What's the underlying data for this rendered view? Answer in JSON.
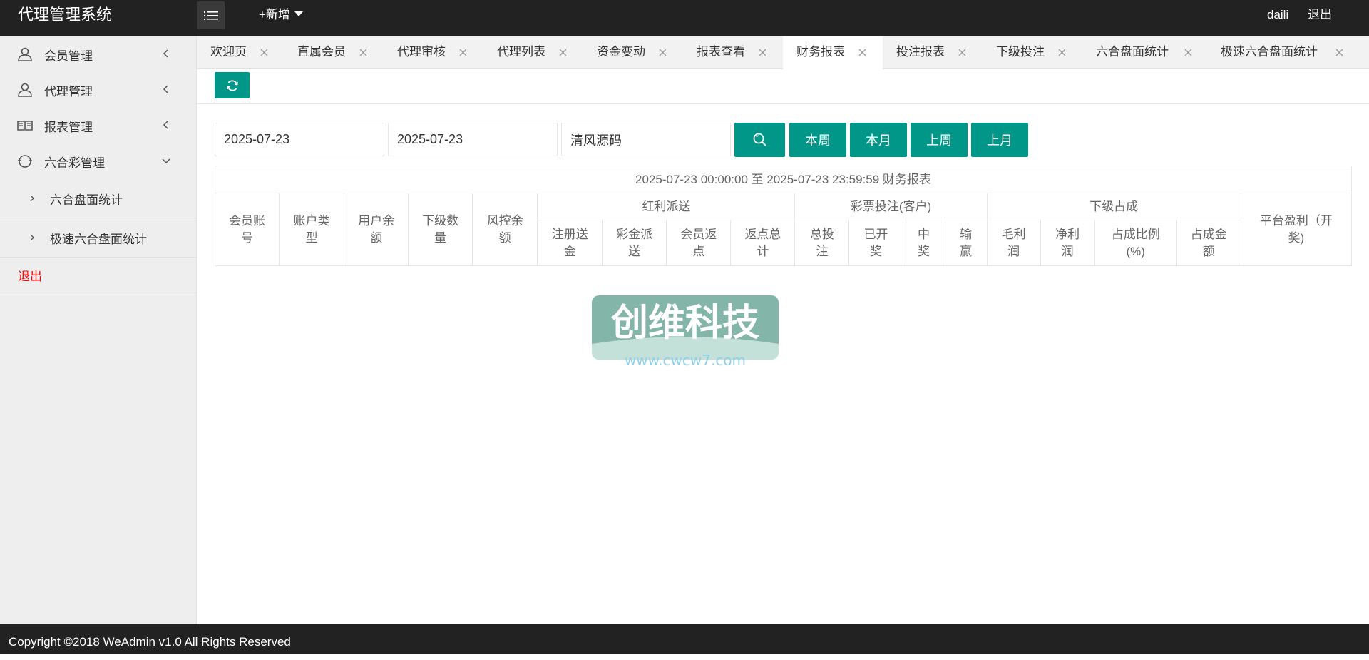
{
  "header": {
    "app_title": "代理管理系统",
    "add_new_label": "+新增",
    "username": "daili",
    "logout_label": "退出"
  },
  "sidebar": {
    "items": [
      {
        "label": "会员管理",
        "icon": "user-icon",
        "expanded": false
      },
      {
        "label": "代理管理",
        "icon": "user-icon",
        "expanded": false
      },
      {
        "label": "报表管理",
        "icon": "book-icon",
        "expanded": false
      },
      {
        "label": "六合彩管理",
        "icon": "lottery-icon",
        "expanded": true
      }
    ],
    "subitems": [
      {
        "label": "六合盘面统计"
      },
      {
        "label": "极速六合盘面统计"
      }
    ],
    "exit_label": "退出"
  },
  "tabs": [
    {
      "label": "欢迎页"
    },
    {
      "label": "直属会员"
    },
    {
      "label": "代理审核"
    },
    {
      "label": "代理列表"
    },
    {
      "label": "资金变动"
    },
    {
      "label": "报表查看"
    },
    {
      "label": "财务报表",
      "active": true
    },
    {
      "label": "投注报表"
    },
    {
      "label": "下级投注"
    },
    {
      "label": "六合盘面统计"
    },
    {
      "label": "极速六合盘面统计"
    }
  ],
  "filters": {
    "start_date": "2025-07-23",
    "end_date": "2025-07-23",
    "keyword": "清风源码",
    "btn_this_week": "本周",
    "btn_this_month": "本月",
    "btn_last_week": "上周",
    "btn_last_month": "上月"
  },
  "table": {
    "caption": "2025-07-23 00:00:00 至 2025-07-23 23:59:59 财务报表",
    "col_member_account": "会员账号",
    "col_account_type": "账户类型",
    "col_user_balance": "用户余额",
    "col_sub_count": "下级数量",
    "col_risk_balance": "风控余额",
    "group_bonus": "红利派送",
    "col_reg_bonus": "注册送金",
    "col_jackpot": "彩金派送",
    "col_member_rebate": "会员返点",
    "col_rebate_total": "返点总计",
    "group_bets": "彩票投注(客户)",
    "col_total_bets": "总投注",
    "col_drawn": "已开奖",
    "col_win": "中奖",
    "col_win_loss": "输赢",
    "group_share": "下级占成",
    "col_gross_profit": "毛利润",
    "col_net_profit": "净利润",
    "col_share_ratio": "占成比例(%)",
    "col_share_amount": "占成金额",
    "col_platform_profit": "平台盈利（开奖)"
  },
  "watermark": {
    "brand": "创维科技",
    "url": "www.cwcw7.com"
  },
  "footer": {
    "copyright": "Copyright ©2018 WeAdmin v1.0 All Rights Reserved"
  },
  "colors": {
    "primary": "#009688",
    "header_bg": "#222222",
    "sidebar_bg": "#eeeeee",
    "danger": "#ff0000"
  }
}
